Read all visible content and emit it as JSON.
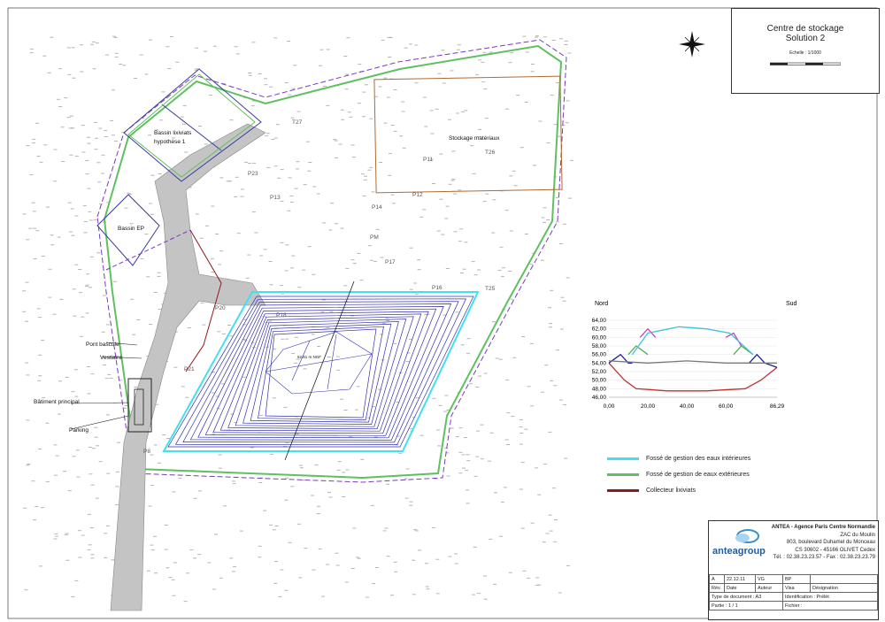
{
  "title": {
    "line1": "Centre de stockage",
    "line2": "Solution 2",
    "scale": "Echelle : 1/1000"
  },
  "map_labels": {
    "bassin_lixiviats": "Bassin lixiviats",
    "hypothese": "hypothèse 1",
    "bassin_ep": "Bassin EP",
    "stockage": "Stockage matériaux",
    "pont_bascule": "Pont bascule",
    "vestiaire": "Vestiaire",
    "batiment": "Bâtiment principal",
    "parking": "Parking",
    "summit": "52.81 m NGF",
    "points": [
      "T27",
      "P23",
      "P13",
      "P14",
      "P11",
      "T26",
      "P12",
      "PM",
      "P17",
      "P16",
      "T25",
      "P20",
      "P21",
      "P18",
      "P8"
    ]
  },
  "chart_data": {
    "type": "line",
    "title": "",
    "left_label": "Nord",
    "right_label": "Sud",
    "ylim": [
      46,
      64
    ],
    "yticks": [
      "64,00",
      "62,00",
      "60,00",
      "58,00",
      "56,00",
      "54,00",
      "52,00",
      "50,00",
      "48,00",
      "46,00"
    ],
    "xlim": [
      0,
      86.29
    ],
    "xticks": [
      "0,00",
      "20,00",
      "40,00",
      "60,00",
      "86,29"
    ],
    "series": [
      {
        "color": "#c03030",
        "x": [
          0,
          8,
          14,
          30,
          50,
          70,
          78,
          86.29
        ],
        "y": [
          54,
          50,
          48,
          47.5,
          47.5,
          48,
          50,
          53
        ]
      },
      {
        "color": "#2020a0",
        "x": [
          0,
          6,
          10,
          12
        ],
        "y": [
          54,
          56,
          54,
          54
        ]
      },
      {
        "color": "#2020a0",
        "x": [
          72,
          76,
          80,
          86.29
        ],
        "y": [
          54,
          56,
          54,
          53
        ]
      },
      {
        "color": "#50b050",
        "x": [
          10,
          14,
          20
        ],
        "y": [
          56,
          58,
          56
        ]
      },
      {
        "color": "#50b050",
        "x": [
          64,
          68,
          74
        ],
        "y": [
          56,
          58,
          56
        ]
      },
      {
        "color": "#c040c0",
        "x": [
          16,
          20,
          24
        ],
        "y": [
          60,
          62,
          60
        ]
      },
      {
        "color": "#c040c0",
        "x": [
          60,
          64,
          68
        ],
        "y": [
          60,
          61,
          58
        ]
      },
      {
        "color": "#40c0e0",
        "x": [
          12,
          20,
          36,
          50,
          62,
          74
        ],
        "y": [
          56,
          61,
          62.5,
          62,
          61,
          56
        ]
      },
      {
        "color": "#777777",
        "x": [
          0,
          20,
          40,
          60,
          86.29
        ],
        "y": [
          54.5,
          54,
          54.5,
          54,
          54
        ]
      }
    ]
  },
  "legend": [
    {
      "label": "Fossé de gestion des eaux intérieures",
      "color": "#40e0f0"
    },
    {
      "label": "Fossé de gestion de eaux extérieures",
      "color": "#60c060"
    },
    {
      "label": "Collecteur lixiviats",
      "color": "#8b1a1a"
    }
  ],
  "cartouche": {
    "brand": "anteagroup",
    "address": [
      "ANTEA - Agence Paris Centre Normandie",
      "ZAC du Moulin",
      "803, boulevard Duhamel du Monceau",
      "CS 30602 - 45166 OLIVET Cedex",
      "Tél. : 02.38.23.23.57 - Fax : 02.38.23.23.79"
    ],
    "row1": [
      "A",
      "22.12.11",
      "VG",
      "BP",
      ""
    ],
    "row2": [
      "Rév.",
      "Date",
      "Auteur",
      "Visa",
      "Désignation"
    ],
    "type_doc": "Type de document : A3",
    "identification": "Identification : Prélèt",
    "partie": "Partie : 1 / 1",
    "fichier": "Fichier :"
  }
}
